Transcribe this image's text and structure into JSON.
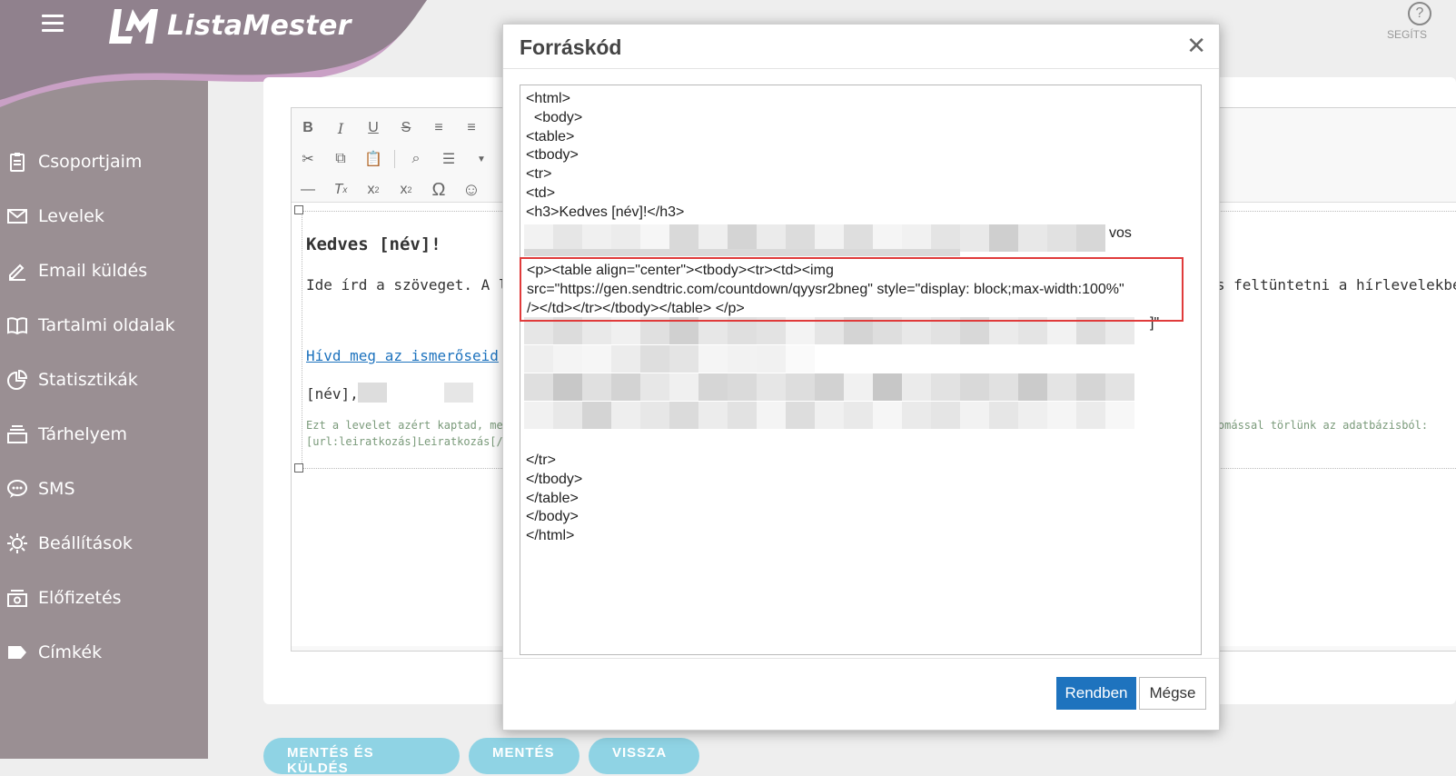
{
  "app": {
    "brand": "ListaMester",
    "help_label": "SEGÍTS"
  },
  "sidebar": {
    "items": [
      {
        "label": "Csoportjaim",
        "icon": "clipboard-icon"
      },
      {
        "label": "Levelek",
        "icon": "envelope-icon"
      },
      {
        "label": "Email küldés",
        "icon": "pen-icon"
      },
      {
        "label": "Tartalmi oldalak",
        "icon": "book-icon"
      },
      {
        "label": "Statisztikák",
        "icon": "pie-chart-icon"
      },
      {
        "label": "Tárhelyem",
        "icon": "storage-icon"
      },
      {
        "label": "SMS",
        "icon": "chat-icon"
      },
      {
        "label": "Beállítások",
        "icon": "gear-icon"
      },
      {
        "label": "Előfizetés",
        "icon": "money-icon"
      },
      {
        "label": "Címkék",
        "icon": "tag-icon"
      }
    ]
  },
  "editor": {
    "heading": "Kedves [név]!",
    "para_start": "Ide írd a szöveget. A ler",
    "para_end": "ó is feltüntetni a hírlevelekben",
    "link": "Hívd meg az ismerőseid",
    "name_line": "[név],",
    "footer_line1": "Ezt a levelet azért kaptad, me",
    "footer_line1_end": "ohnyomással törlünk az adatbázisból:",
    "footer_line2": "[url:leiratkozás]Leiratkozás[/u"
  },
  "bottom_buttons": [
    "MENTÉS ÉS KÜLDÉS",
    "MENTÉS",
    "VISSZA"
  ],
  "modal": {
    "title": "Forráskód",
    "code_top": "<html>\n  <body>\n<table>\n<tbody>\n<tr>\n<td>\n<h3>Kedves [név]!</h3>",
    "code_partial_1": "vos",
    "highlight_lines": "<p><table align=\"center\"><tbody><tr><td><img\nsrc=\"https://gen.sendtric.com/countdown/qyysr2bneg\" style=\"display: block;max-width:100%\"\n/></td></tr></tbody></table> </p>",
    "code_partial_2": "]\"",
    "code_bottom": "</tr>\n</tbody>\n</table>\n</body>\n</html>",
    "ok_label": "Rendben",
    "cancel_label": "Mégse"
  }
}
